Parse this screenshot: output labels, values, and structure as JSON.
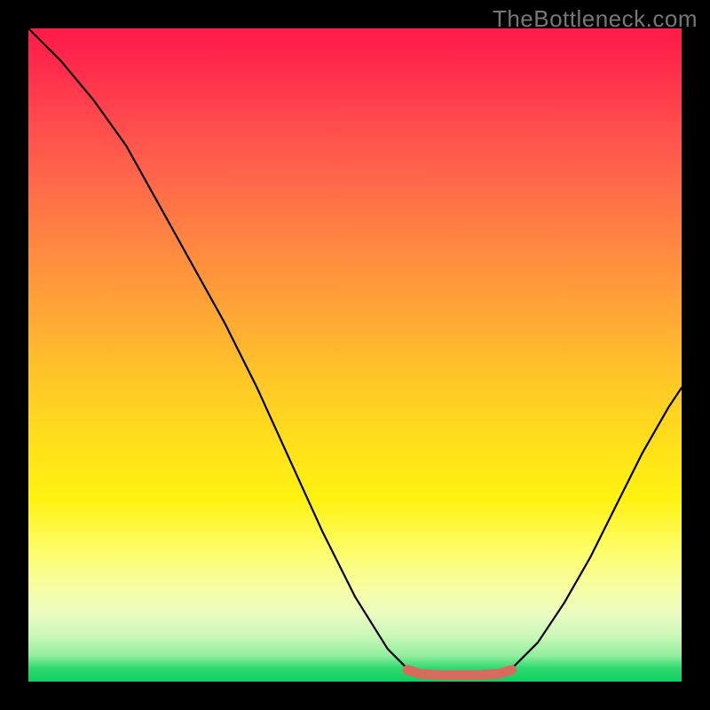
{
  "watermark": "TheBottleneck.com",
  "chart_data": {
    "type": "line",
    "title": "",
    "xlabel": "",
    "ylabel": "",
    "ylim": [
      0,
      1
    ],
    "xlim": [
      0,
      1
    ],
    "series": [
      {
        "name": "bottleneck-curve",
        "points": [
          {
            "x": 0.0,
            "y": 1.0
          },
          {
            "x": 0.05,
            "y": 0.95
          },
          {
            "x": 0.1,
            "y": 0.89
          },
          {
            "x": 0.15,
            "y": 0.82
          },
          {
            "x": 0.2,
            "y": 0.73
          },
          {
            "x": 0.25,
            "y": 0.64
          },
          {
            "x": 0.3,
            "y": 0.55
          },
          {
            "x": 0.35,
            "y": 0.45
          },
          {
            "x": 0.4,
            "y": 0.34
          },
          {
            "x": 0.45,
            "y": 0.23
          },
          {
            "x": 0.5,
            "y": 0.13
          },
          {
            "x": 0.55,
            "y": 0.05
          },
          {
            "x": 0.58,
            "y": 0.02
          },
          {
            "x": 0.6,
            "y": 0.012
          },
          {
            "x": 0.63,
            "y": 0.01
          },
          {
            "x": 0.66,
            "y": 0.01
          },
          {
            "x": 0.69,
            "y": 0.01
          },
          {
            "x": 0.72,
            "y": 0.012
          },
          {
            "x": 0.74,
            "y": 0.02
          },
          {
            "x": 0.78,
            "y": 0.06
          },
          {
            "x": 0.82,
            "y": 0.12
          },
          {
            "x": 0.86,
            "y": 0.19
          },
          {
            "x": 0.9,
            "y": 0.27
          },
          {
            "x": 0.94,
            "y": 0.35
          },
          {
            "x": 0.98,
            "y": 0.42
          },
          {
            "x": 1.0,
            "y": 0.45
          }
        ]
      },
      {
        "name": "optimal-band",
        "color": "#d86a5e",
        "points": [
          {
            "x": 0.58,
            "y": 0.018
          },
          {
            "x": 0.6,
            "y": 0.012
          },
          {
            "x": 0.63,
            "y": 0.01
          },
          {
            "x": 0.66,
            "y": 0.01
          },
          {
            "x": 0.69,
            "y": 0.01
          },
          {
            "x": 0.72,
            "y": 0.012
          },
          {
            "x": 0.74,
            "y": 0.018
          }
        ]
      }
    ],
    "gradient_stops": [
      {
        "pos": 0.0,
        "color": "#ff1b4a"
      },
      {
        "pos": 0.5,
        "color": "#ffc727"
      },
      {
        "pos": 0.8,
        "color": "#fdfd6a"
      },
      {
        "pos": 1.0,
        "color": "#0ecf61"
      }
    ]
  }
}
